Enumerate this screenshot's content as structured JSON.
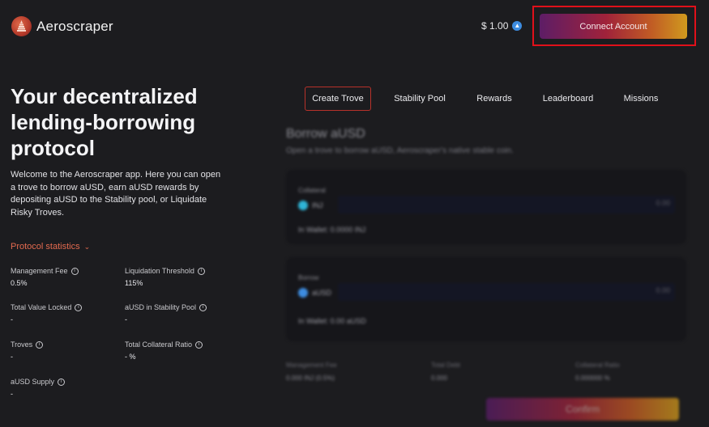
{
  "brand": {
    "name": "Aeroscraper"
  },
  "header": {
    "price": "$ 1.00",
    "connect_label": "Connect Account"
  },
  "hero": {
    "title": "Your decentralized lending-borrowing protocol",
    "description": "Welcome to the Aeroscraper app. Here you can open a trove to borrow aUSD, earn aUSD rewards by depositing aUSD to the Stability pool, or Liquidate Risky Troves."
  },
  "stats": {
    "toggle_label": "Protocol statistics",
    "items": [
      {
        "label": "Management Fee",
        "value": "0.5%"
      },
      {
        "label": "Liquidation Threshold",
        "value": "115%"
      },
      {
        "label": "Total Value Locked",
        "value": "-"
      },
      {
        "label": "aUSD in Stability Pool",
        "value": "-"
      },
      {
        "label": "Troves",
        "value": "-"
      },
      {
        "label": "Total Collateral Ratio",
        "value": "- %"
      },
      {
        "label": "aUSD Supply",
        "value": "-"
      }
    ]
  },
  "tabs": [
    {
      "label": "Create Trove",
      "active": true
    },
    {
      "label": "Stability Pool",
      "active": false
    },
    {
      "label": "Rewards",
      "active": false
    },
    {
      "label": "Leaderboard",
      "active": false
    },
    {
      "label": "Missions",
      "active": false
    }
  ],
  "borrow": {
    "title": "Borrow aUSD",
    "subtitle": "Open a trove to borrow aUSD, Aeroscraper's native stable coin.",
    "collateral": {
      "label": "Collateral",
      "token": "INJ",
      "amount": "0.00",
      "wallet": "In Wallet: 0.0000 INJ",
      "icon": "injective-icon",
      "color": "#2fb4d6"
    },
    "borrow_card": {
      "label": "Borrow",
      "token": "aUSD",
      "amount": "0.00",
      "wallet": "In Wallet: 0.00 aUSD",
      "icon": "ausd-icon",
      "color": "#3d8ce0"
    },
    "summary": [
      {
        "label": "Management Fee",
        "value": "0.000 INJ (0.5%)"
      },
      {
        "label": "Total Debt",
        "value": "0.000"
      },
      {
        "label": "Collateral Ratio",
        "value": "0.000000 %"
      }
    ],
    "confirm_label": "Confirm"
  },
  "colors": {
    "accent": "#e36a4f",
    "highlight_border": "#e0101a",
    "background": "#1c1c1f"
  }
}
